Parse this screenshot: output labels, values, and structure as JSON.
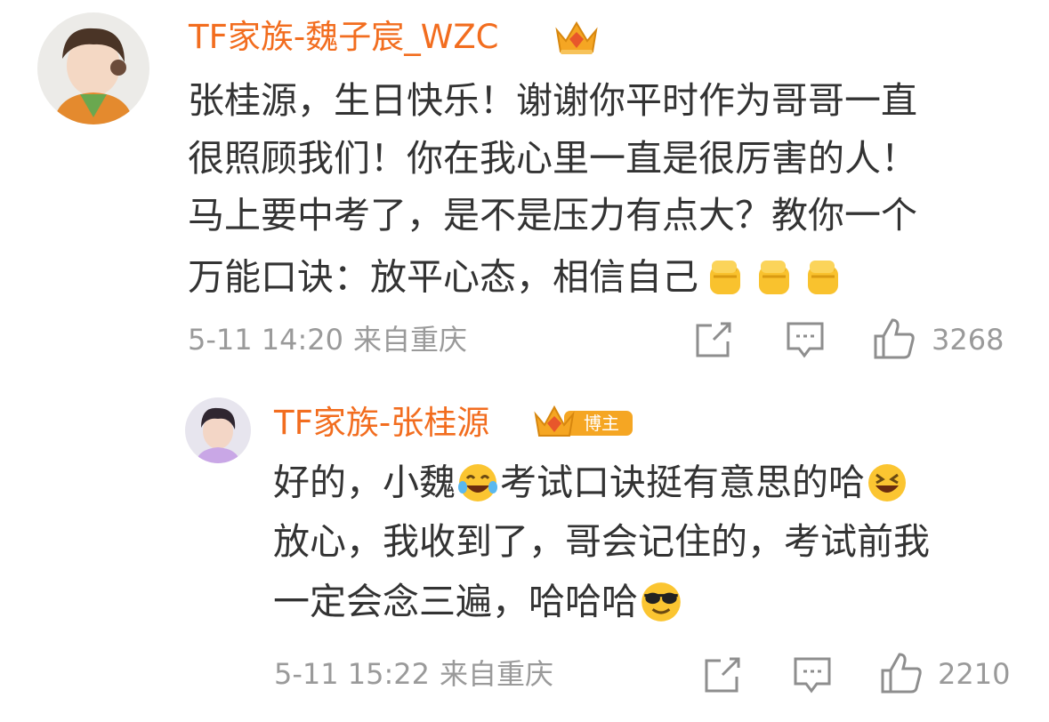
{
  "comment": {
    "author": "TF家族-魏子宸_WZC",
    "lines": [
      "张桂源，生日快乐！谢谢你平时作为哥哥一直",
      "很照顾我们！你在我心里一直是很厉害的人！",
      "马上要中考了，是不是压力有点大？教你一个",
      "万能口诀：放平心态，相信自己"
    ],
    "time": "5-11 14:20",
    "location": "来自重庆",
    "like_count": "3268",
    "emojis": [
      "fist-emoji",
      "fist-emoji",
      "fist-emoji"
    ]
  },
  "reply": {
    "author": "TF家族-张桂源",
    "badge": "博主",
    "lines": {
      "line1_a": "好的，小魏",
      "line1_b": "考试口诀挺有意思的哈",
      "line2": "放心，我收到了，哥会记住的，考试前我",
      "line3": "一定会念三遍，哈哈哈"
    },
    "time": "5-11 15:22",
    "location": "来自重庆",
    "like_count": "2210",
    "emojis": [
      "laugh-tears-emoji",
      "grin-squint-emoji",
      "sunglasses-emoji"
    ]
  },
  "colors": {
    "name": "#f26d1f",
    "text": "#333333",
    "meta": "#9a9a9a",
    "crown": "#f5a623"
  }
}
